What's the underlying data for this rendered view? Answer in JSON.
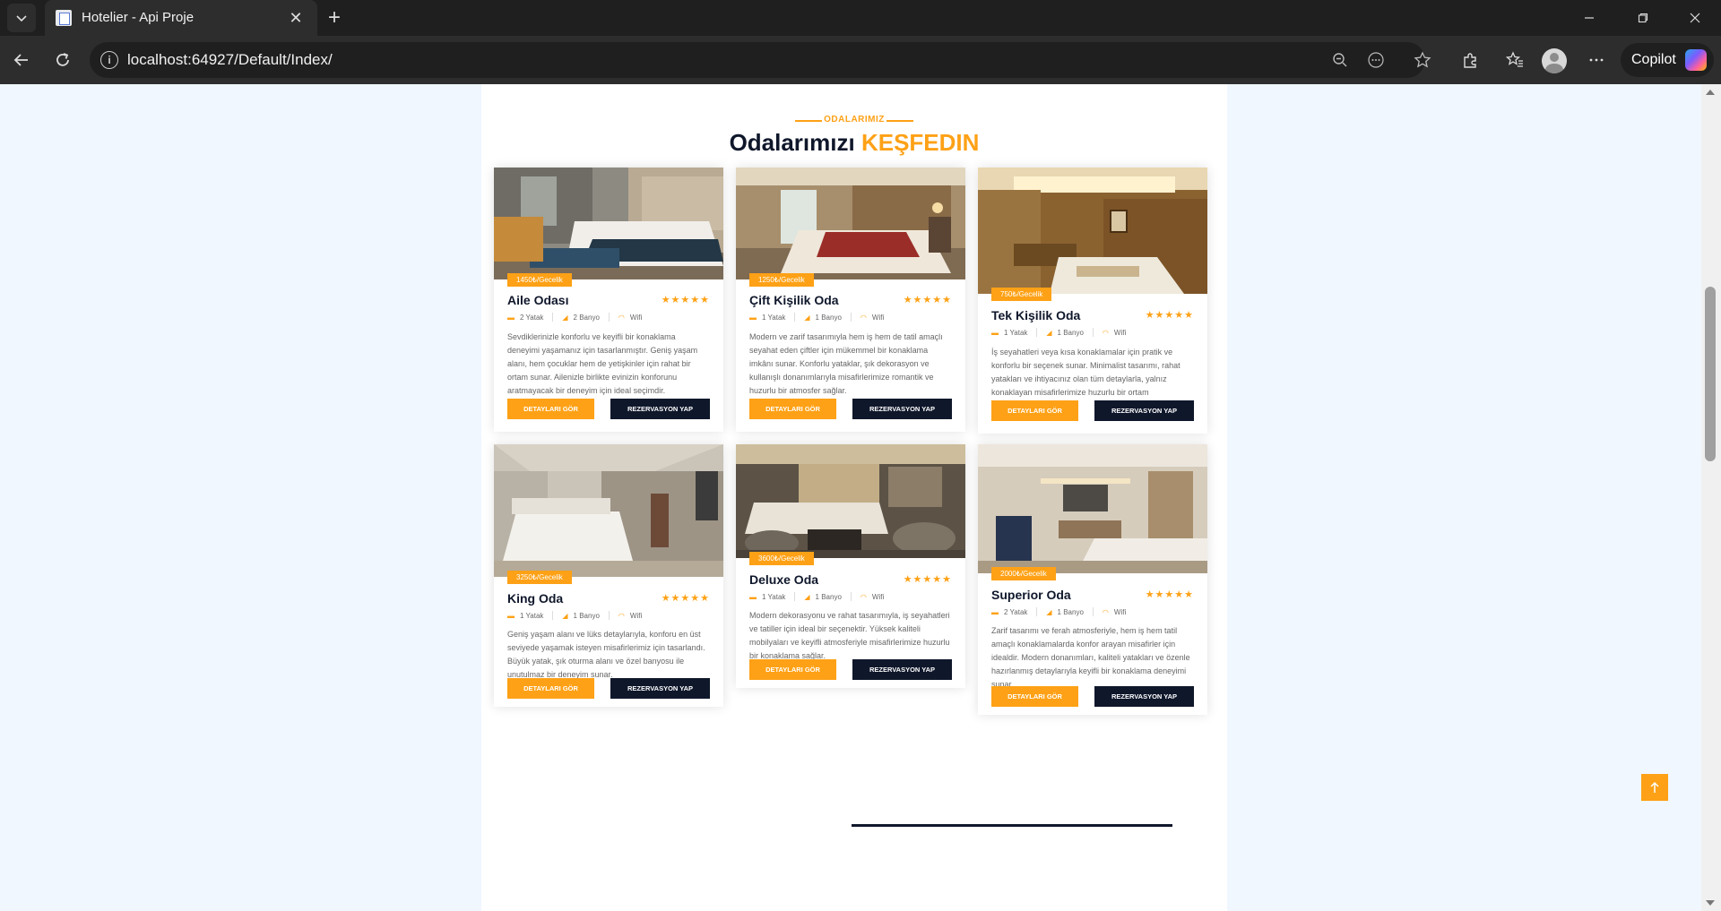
{
  "browser": {
    "tab_title": "Hotelier - Api Proje",
    "url": "localhost:64927/Default/Index/",
    "copilot_label": "Copilot"
  },
  "section": {
    "subtitle": "ODALARIMIZ",
    "title_main": "Odalarımızı",
    "title_accent": "KEŞFEDIN"
  },
  "buttons": {
    "details": "DETAYLARI GÖR",
    "reserve": "REZERVASYON YAP"
  },
  "rooms": [
    {
      "name": "Aile Odası",
      "price": "1450₺/Gecelik",
      "beds": "2 Yatak",
      "baths": "2 Banyo",
      "wifi": "Wifi",
      "rating": "★★★★★",
      "description": "Sevdiklerinizle konforlu ve keyifli bir konaklama deneyimi yaşamanız için tasarlanmıştır. Geniş yaşam alanı, hem çocuklar hem de yetişkinler için rahat bir ortam sunar. Ailenizle birlikte evinizin konforunu aratmayacak bir deneyim için ideal seçimdir."
    },
    {
      "name": "Çift Kişilik Oda",
      "price": "1250₺/Gecelik",
      "beds": "1 Yatak",
      "baths": "1 Banyo",
      "wifi": "Wifi",
      "rating": "★★★★★",
      "description": "Modern ve zarif tasarımıyla hem iş hem de tatil amaçlı seyahat eden çiftler için mükemmel bir konaklama imkânı sunar. Konforlu yataklar, şık dekorasyon ve kullanışlı donanımlarıyla misafirlerimize romantik ve huzurlu bir atmosfer sağlar."
    },
    {
      "name": "Tek Kişilik Oda",
      "price": "750₺/Gecelik",
      "beds": "1 Yatak",
      "baths": "1 Banyo",
      "wifi": "Wifi",
      "rating": "★★★★★",
      "description": "İş seyahatleri veya kısa konaklamalar için pratik ve konforlu bir seçenek sunar. Minimalist tasarımı, rahat yatakları ve ihtiyacınız olan tüm detaylarla, yalnız konaklayan misafirlerimize huzurlu bir ortam sağlamaktadır."
    },
    {
      "name": "King Oda",
      "price": "3250₺/Gecelik",
      "beds": "1 Yatak",
      "baths": "1 Banyo",
      "wifi": "Wifi",
      "rating": "★★★★★",
      "description": "Geniş yaşam alanı ve lüks detaylarıyla, konforu en üst seviyede yaşamak isteyen misafirlerimiz için tasarlandı. Büyük yatak, şık oturma alanı ve özel banyosu ile unutulmaz bir deneyim sunar."
    },
    {
      "name": "Deluxe Oda",
      "price": "3600₺/Gecelik",
      "beds": "1 Yatak",
      "baths": "1 Banyo",
      "wifi": "Wifi",
      "rating": "★★★★★",
      "description": "Modern dekorasyonu ve rahat tasarımıyla, iş seyahatleri ve tatiller için ideal bir seçenektir. Yüksek kaliteli mobilyaları ve keyifli atmosferiyle misafirlerimize huzurlu bir konaklama sağlar."
    },
    {
      "name": "Superior Oda",
      "price": "2000₺/Gecelik",
      "beds": "2 Yatak",
      "baths": "1 Banyo",
      "wifi": "Wifi",
      "rating": "★★★★★",
      "description": "Zarif tasarımı ve ferah atmosferiyle, hem iş hem tatil amaçlı konaklamalarda konfor arayan misafirler için idealdir. Modern donanımları, kaliteli yatakları ve özenle hazırlanmış detaylarıyla keyifli bir konaklama deneyimi sunar."
    }
  ],
  "back_to_top_icon": "arrow-up-icon"
}
